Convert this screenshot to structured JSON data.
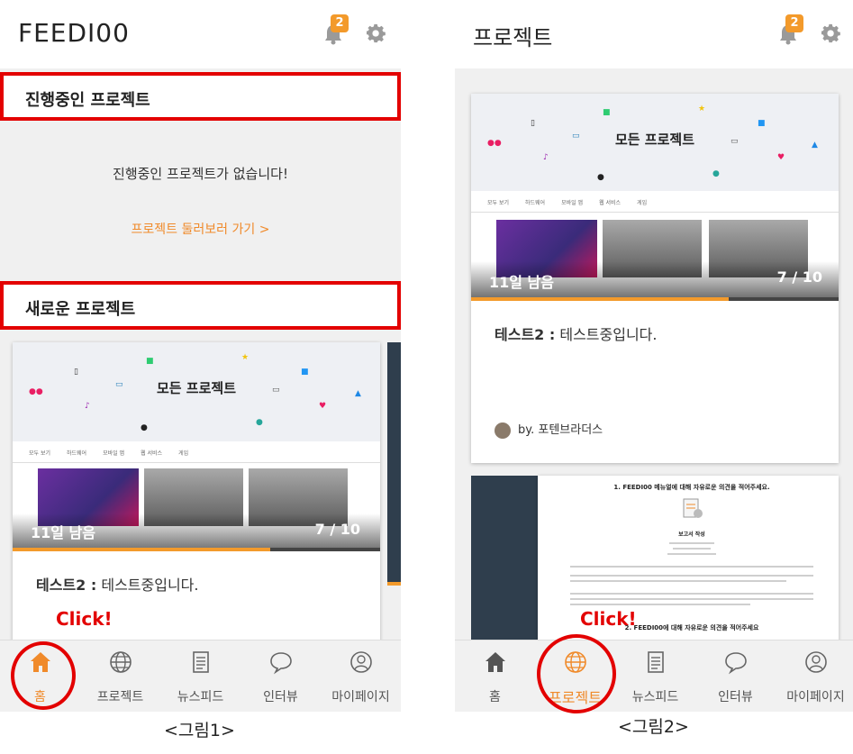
{
  "figure1": {
    "logo": "FEEDI00",
    "badge": "2",
    "section_ongoing": "진행중인 프로젝트",
    "empty_message": "진행중인 프로젝트가 없습니다!",
    "browse_link": "프로젝트 둘러보러 가기 >",
    "section_new": "새로운 프로젝트",
    "card": {
      "preview_title": "모든 프로젝트",
      "mini_tabs": [
        "모두 보기",
        "하드웨어",
        "모바일 앱",
        "웹 서비스",
        "게임"
      ],
      "remaining": "11일 남음",
      "count": "7 / 10",
      "progress": 0.7,
      "title_bold": "테스트2 :",
      "title_rest": " 테스트중입니다."
    },
    "click_label": "Click!",
    "caption": "<그림1>",
    "nav": [
      {
        "label": "홈",
        "icon": "home-icon"
      },
      {
        "label": "프로젝트",
        "icon": "globe-icon"
      },
      {
        "label": "뉴스피드",
        "icon": "document-icon"
      },
      {
        "label": "인터뷰",
        "icon": "chat-bubble-icon"
      },
      {
        "label": "마이페이지",
        "icon": "user-icon"
      }
    ]
  },
  "figure2": {
    "title": "프로젝트",
    "badge": "2",
    "card": {
      "preview_title": "모든 프로젝트",
      "mini_tabs": [
        "모두 보기",
        "하드웨어",
        "모바일 앱",
        "웹 서비스",
        "게임"
      ],
      "remaining": "11일 남음",
      "count": "7 / 10",
      "progress": 0.7,
      "title_bold": "테스트2 :",
      "title_rest": " 테스트중입니다.",
      "author": "by. 포텐브라더스"
    },
    "survey": {
      "q1": "1. FEEDI00 메뉴얼에 대해 자유로운 의견을 적어주세요.",
      "doc_title": "보고서 작성",
      "q2": "2. FEEDI00에 대해 자유로운 의견을 적어주세요"
    },
    "click_label": "Click!",
    "caption": "<그림2>",
    "nav": [
      {
        "label": "홈",
        "icon": "home-icon"
      },
      {
        "label": "프로젝트",
        "icon": "globe-icon"
      },
      {
        "label": "뉴스피드",
        "icon": "document-icon"
      },
      {
        "label": "인터뷰",
        "icon": "chat-bubble-icon"
      },
      {
        "label": "마이페이지",
        "icon": "user-icon"
      }
    ]
  },
  "colors": {
    "accent": "#f08a2a",
    "badge": "#f39a2b",
    "highlight": "#e30000",
    "dark_card": "#2f3e4d"
  }
}
